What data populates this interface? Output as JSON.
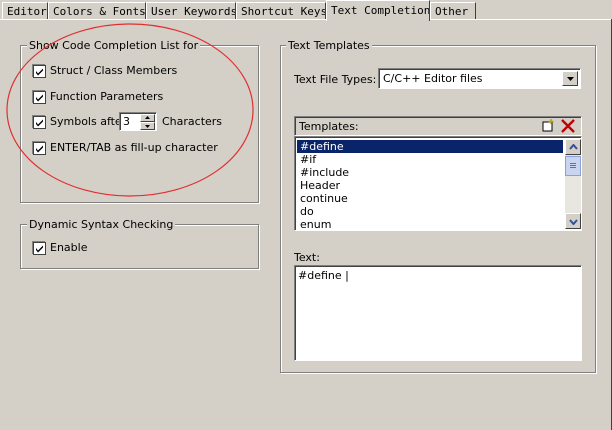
{
  "tabs": [
    {
      "label": "Editor"
    },
    {
      "label": "Colors & Fonts"
    },
    {
      "label": "User Keywords"
    },
    {
      "label": "Shortcut Keys"
    },
    {
      "label": "Text Completion"
    },
    {
      "label": "Other"
    }
  ],
  "completion": {
    "title": "Show Code Completion List for",
    "struct": {
      "label": "Struct / Class Members",
      "checked": true
    },
    "function": {
      "label": "Function Parameters",
      "checked": true
    },
    "symbols": {
      "label": "Symbols after",
      "checked": true,
      "value": "3",
      "suffix": "Characters"
    },
    "enter": {
      "label": "ENTER/TAB as fill-up character",
      "checked": true
    }
  },
  "syntax": {
    "title": "Dynamic Syntax Checking",
    "enable": {
      "label": "Enable",
      "checked": true
    }
  },
  "templates_group": {
    "title": "Text Templates",
    "file_types_label": "Text File Types:",
    "file_types_value": "C/C++ Editor files",
    "templates_label": "Templates:",
    "items": [
      "#define",
      "#if",
      "#include",
      "Header",
      "continue",
      "do",
      "enum"
    ],
    "selected": "#define",
    "text_label": "Text:",
    "text_value": "#define |"
  },
  "annotation": {
    "color": "#e03030"
  }
}
